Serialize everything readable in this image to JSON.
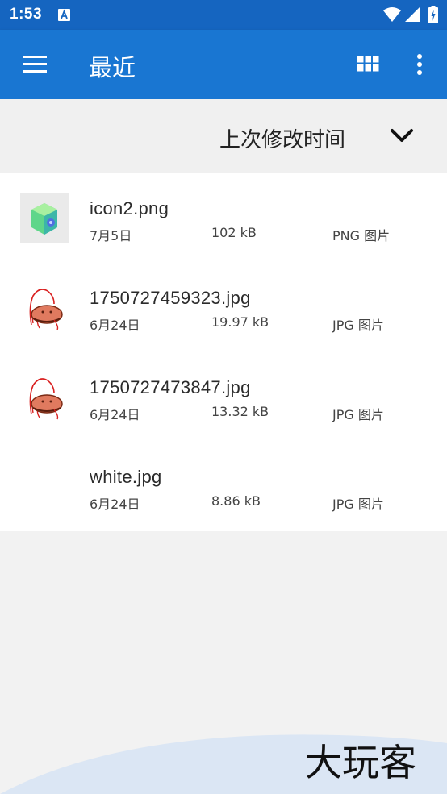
{
  "status_bar": {
    "time": "1:53"
  },
  "app_bar": {
    "title": "最近"
  },
  "sort": {
    "label": "上次修改时间"
  },
  "files": [
    {
      "name": "icon2.png",
      "date": "7月5日",
      "size": "102 kB",
      "type": "PNG 图片",
      "thumb": "cube-icon"
    },
    {
      "name": "1750727459323.jpg",
      "date": "6月24日",
      "size": "19.97 kB",
      "type": "JPG 图片",
      "thumb": "sketch-icon"
    },
    {
      "name": "1750727473847.jpg",
      "date": "6月24日",
      "size": "13.32 kB",
      "type": "JPG 图片",
      "thumb": "sketch-icon"
    },
    {
      "name": "white.jpg",
      "date": "6月24日",
      "size": "8.86 kB",
      "type": "JPG 图片",
      "thumb": "blank"
    }
  ],
  "watermark": {
    "text": "大玩客"
  },
  "colors": {
    "status_bar": "#1565c0",
    "app_bar": "#1976d2",
    "background": "#f2f2f2"
  }
}
